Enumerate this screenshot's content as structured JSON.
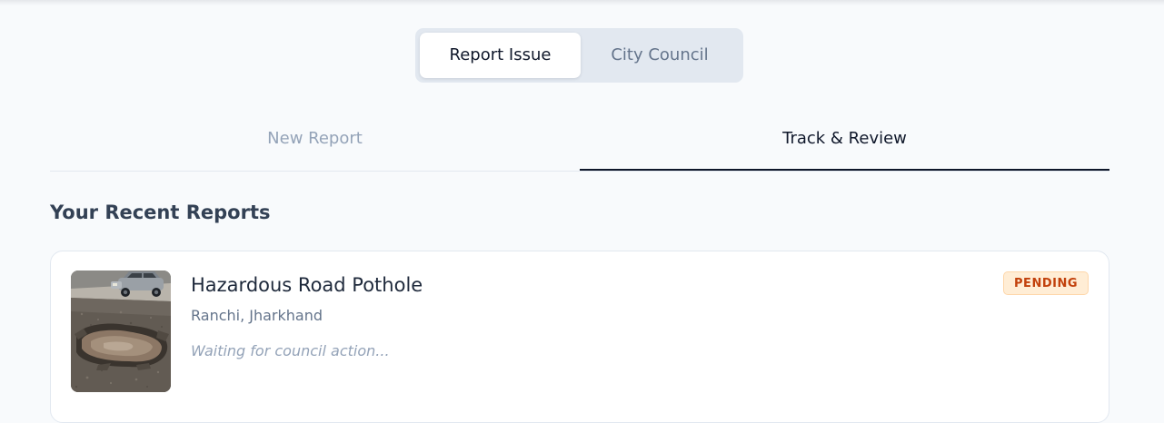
{
  "mode_switch": {
    "options": [
      {
        "label": "Report Issue",
        "active": true
      },
      {
        "label": "City Council",
        "active": false
      }
    ]
  },
  "tabs": [
    {
      "label": "New Report",
      "active": false
    },
    {
      "label": "Track & Review",
      "active": true
    }
  ],
  "section": {
    "title": "Your Recent Reports"
  },
  "reports": [
    {
      "title": "Hazardous Road Pothole",
      "location": "Ranchi, Jharkhand",
      "note": "Waiting for council action...",
      "status": "PENDING",
      "thumbnail": "pothole-photo"
    }
  ],
  "colors": {
    "background": "#f8fafc",
    "active_text": "#0f172a",
    "muted_text": "#94a3b8",
    "status_pending_bg": "#ffedd5",
    "status_pending_text": "#c2410c"
  }
}
